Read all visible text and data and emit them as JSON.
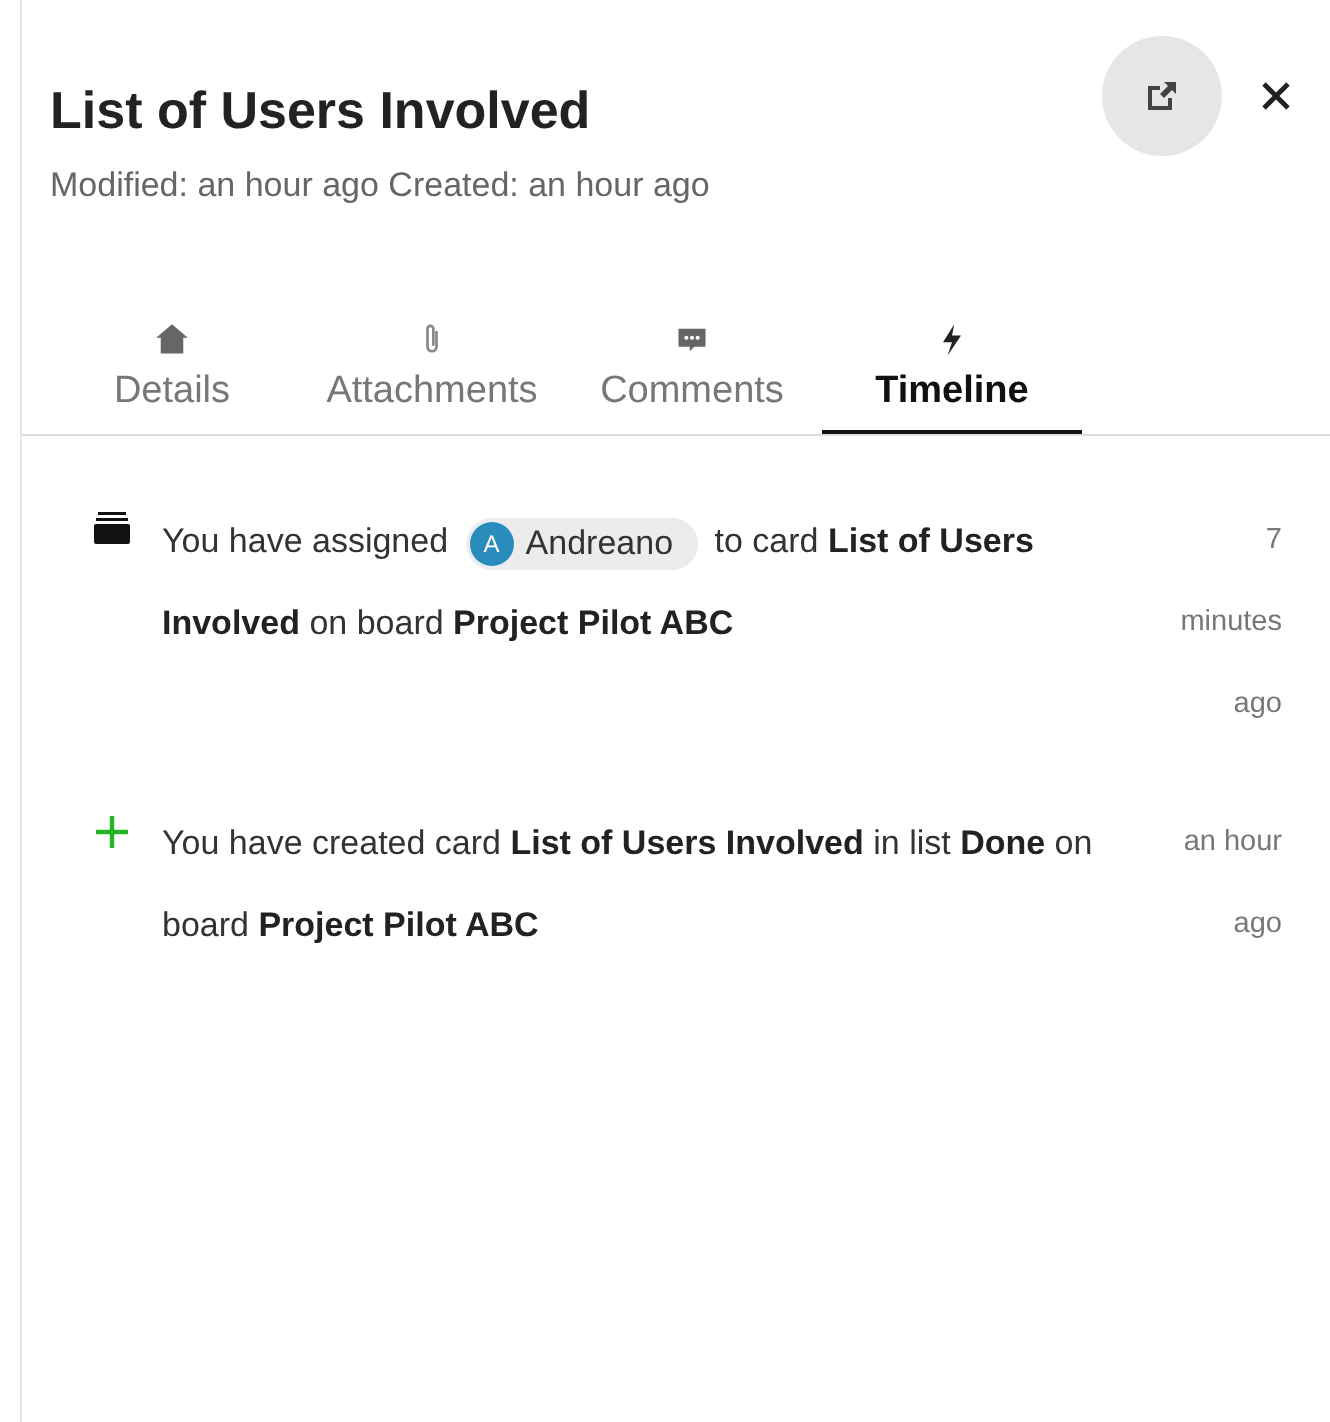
{
  "card": {
    "title": "List of Users Involved",
    "meta": "Modified: an hour ago Created: an hour ago"
  },
  "tabs": [
    {
      "label": "Details",
      "selected": false
    },
    {
      "label": "Attachments",
      "selected": false
    },
    {
      "label": "Comments",
      "selected": false
    },
    {
      "label": "Timeline",
      "selected": true
    }
  ],
  "timeline": [
    {
      "kind": "assigned",
      "before": "You have assigned",
      "mention": {
        "initial": "A",
        "name": "Andreano"
      },
      "after": "to card **List of Users Involved** on board **Project Pilot ABC**",
      "time": "7 minutes ago"
    },
    {
      "kind": "created",
      "before": "You have created card **List of Users Involved** in list **Done** on board **Project Pilot ABC**",
      "time": "an hour ago"
    }
  ]
}
